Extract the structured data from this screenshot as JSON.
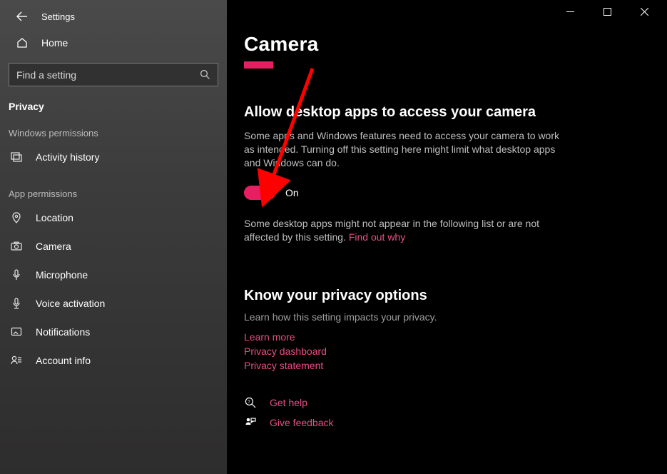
{
  "window": {
    "app_name": "Settings"
  },
  "sidebar": {
    "home": "Home",
    "search_placeholder": "Find a setting",
    "current_category": "Privacy",
    "group_windows": "Windows permissions",
    "group_apps": "App permissions",
    "items_windows": [
      {
        "label": "Activity history"
      }
    ],
    "items_apps": [
      {
        "label": "Location"
      },
      {
        "label": "Camera"
      },
      {
        "label": "Microphone"
      },
      {
        "label": "Voice activation"
      },
      {
        "label": "Notifications"
      },
      {
        "label": "Account info"
      }
    ]
  },
  "main": {
    "title": "Camera",
    "section_heading": "Allow desktop apps to access your camera",
    "section_desc": "Some apps and Windows features need to access your camera to work as intended. Turning off this setting here might limit what desktop apps and Windows can do.",
    "toggle_state": "On",
    "note_prefix": "Some desktop apps might not appear in the following list or are not affected by this setting. ",
    "note_link": "Find out why",
    "privacy_heading": "Know your privacy options",
    "privacy_sub": "Learn how this setting impacts your privacy.",
    "links": {
      "learn_more": "Learn more",
      "dashboard": "Privacy dashboard",
      "statement": "Privacy statement"
    },
    "help": {
      "get_help": "Get help",
      "feedback": "Give feedback"
    }
  }
}
